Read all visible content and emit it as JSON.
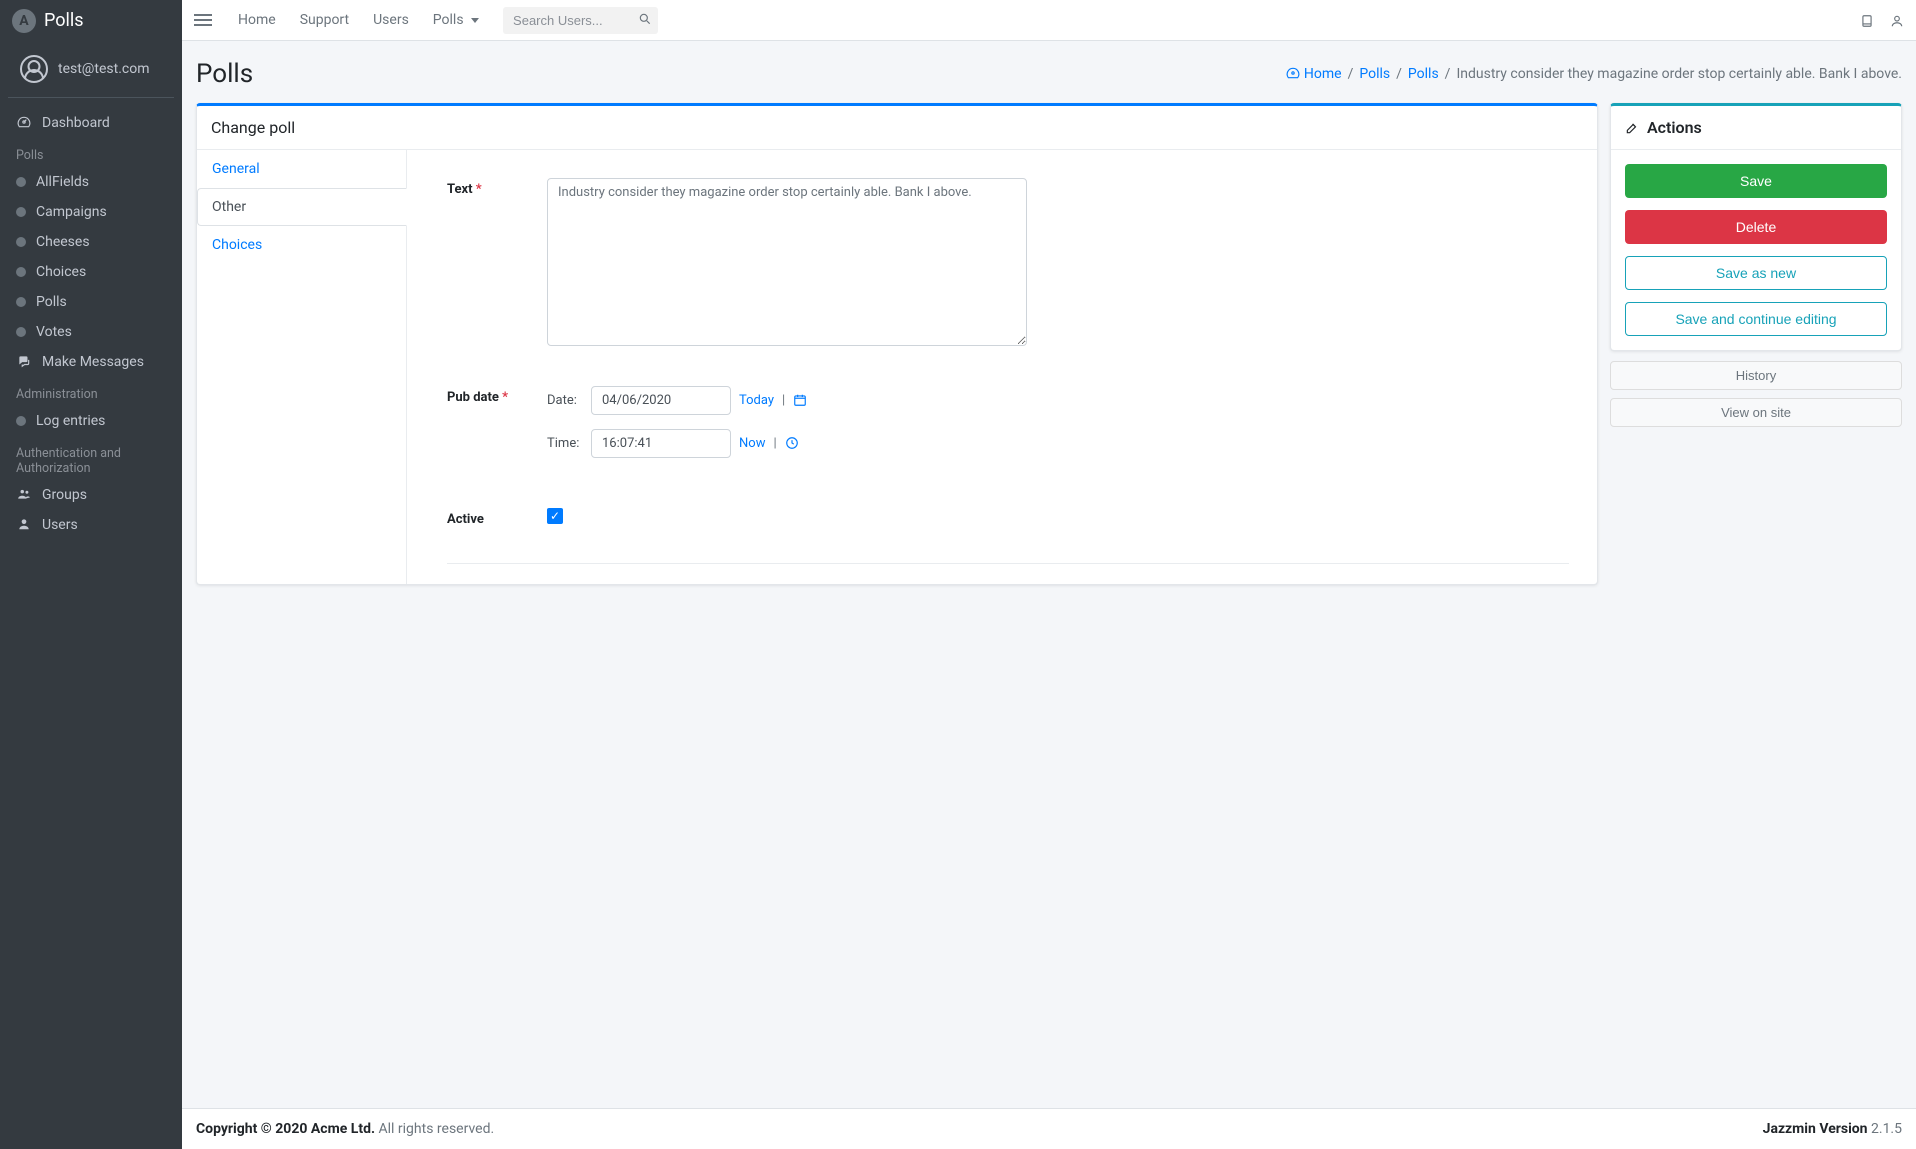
{
  "brand": {
    "name": "Polls"
  },
  "user": {
    "email": "test@test.com"
  },
  "sidebar": {
    "dashboard": "Dashboard",
    "sections": [
      {
        "header": "Polls",
        "items": [
          {
            "label": "AllFields"
          },
          {
            "label": "Campaigns"
          },
          {
            "label": "Cheeses"
          },
          {
            "label": "Choices"
          },
          {
            "label": "Polls"
          },
          {
            "label": "Votes"
          }
        ],
        "extra": [
          {
            "label": "Make Messages",
            "icon": "comments"
          }
        ]
      },
      {
        "header": "Administration",
        "items": [
          {
            "label": "Log entries"
          }
        ]
      },
      {
        "header": "Authentication and Authorization",
        "items_iconed": [
          {
            "label": "Groups",
            "icon": "users"
          },
          {
            "label": "Users",
            "icon": "user"
          }
        ]
      }
    ]
  },
  "topnav": {
    "links": [
      "Home",
      "Support",
      "Users"
    ],
    "dropdown": "Polls",
    "search_placeholder": "Search Users..."
  },
  "page": {
    "title": "Polls",
    "breadcrumb": {
      "home": "Home",
      "polls1": "Polls",
      "polls2": "Polls",
      "current": "Industry consider they magazine order stop certainly able. Bank I above."
    }
  },
  "card": {
    "title": "Change poll",
    "tabs": [
      "General",
      "Other",
      "Choices"
    ],
    "active_tab": "Other"
  },
  "fields": {
    "text_label": "Text",
    "text_value": "Industry consider they magazine order stop certainly able. Bank I above.",
    "pubdate_label": "Pub date",
    "date_lbl": "Date:",
    "date_value": "04/06/2020",
    "today": "Today",
    "time_lbl": "Time:",
    "time_value": "16:07:41",
    "now": "Now",
    "active_label": "Active",
    "active_checked": true
  },
  "actions": {
    "title": "Actions",
    "save": "Save",
    "delete": "Delete",
    "save_as_new": "Save as new",
    "save_continue": "Save and continue editing",
    "history": "History",
    "view_on_site": "View on site"
  },
  "footer": {
    "copyright_strong": "Copyright © 2020 Acme Ltd.",
    "copyright_rest": " All rights reserved.",
    "version_label": "Jazzmin Version",
    "version_value": " 2.1.5"
  }
}
